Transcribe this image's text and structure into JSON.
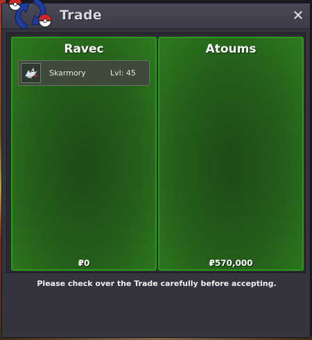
{
  "window": {
    "title": "Trade",
    "close_glyph": "✕",
    "logo_icon": "trade-arrows-pokeball-icon"
  },
  "left_panel": {
    "player": "Ravec",
    "money": "₽0",
    "pokemon": [
      {
        "name": "Skarmory",
        "level": "Lvl: 45",
        "icon": "skarmory-sprite-icon"
      }
    ]
  },
  "right_panel": {
    "player": "Atoums",
    "money": "₽570,000",
    "pokemon": []
  },
  "notice": "Please check over the Trade carefully before accepting.",
  "colors": {
    "panel_border": "#2a9a1a",
    "panel_fill": "#245f1a",
    "window_bg": "#34343f"
  }
}
